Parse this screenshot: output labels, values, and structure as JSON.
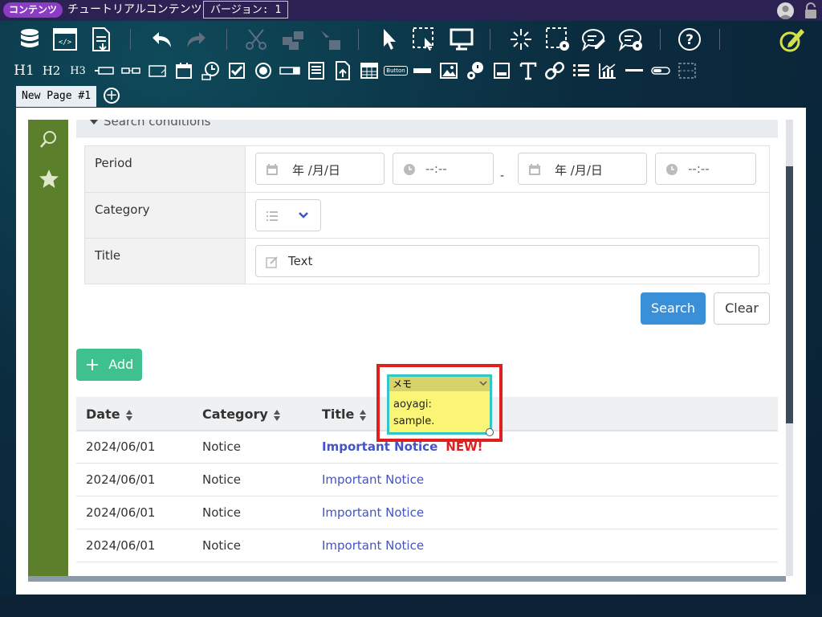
{
  "topbar": {
    "badge": "コンテンツ",
    "title": "チュートリアルコンテンツ",
    "version": "バージョン: 1"
  },
  "toolbar_row1": [
    "database-icon",
    "html-editor-icon",
    "export-file-icon",
    "undo-icon",
    "redo-icon",
    "cut-icon",
    "copy-icon",
    "paste-icon",
    "pointer-icon",
    "select-area-icon",
    "preview-monitor-icon",
    "sparkle-icon",
    "area-settings-icon",
    "comment-edit-icon",
    "comment-settings-icon",
    "help-icon",
    "edit-pencil-icon"
  ],
  "toolbar_row2": {
    "h1": "H1",
    "h2": "H2",
    "h3": "H3",
    "button_tool": "Button"
  },
  "tabs": [
    {
      "label": "New Page #1"
    }
  ],
  "search": {
    "header": "Search conditions",
    "period_label": "Period",
    "date_placeholder": "年 /月/日",
    "time_placeholder": "--:--",
    "range_separator": "-",
    "category_label": "Category",
    "title_label": "Title",
    "title_placeholder": "Text",
    "search_button": "Search",
    "clear_button": "Clear"
  },
  "add_button": "Add",
  "list": {
    "columns": [
      "Date",
      "Category",
      "Title"
    ],
    "rows": [
      {
        "date": "2024/06/01",
        "category": "Notice",
        "title": "Important Notice",
        "badge": "NEW!"
      },
      {
        "date": "2024/06/01",
        "category": "Notice",
        "title": "Important Notice"
      },
      {
        "date": "2024/06/01",
        "category": "Notice",
        "title": "Important Notice"
      },
      {
        "date": "2024/06/01",
        "category": "Notice",
        "title": "Important Notice"
      }
    ]
  },
  "memo": {
    "header": "メモ",
    "line1": "aoyagi:",
    "line2": "sample."
  },
  "colors": {
    "accent_purple": "#8a3cc4",
    "sidebar_green": "#5b7f2a",
    "search_blue": "#3a8fd9",
    "add_green": "#3ec18e",
    "link_blue": "#4453c5",
    "new_red": "#e02020",
    "memo_yellow": "#fbf576",
    "highlight_red": "#e01f1f"
  }
}
